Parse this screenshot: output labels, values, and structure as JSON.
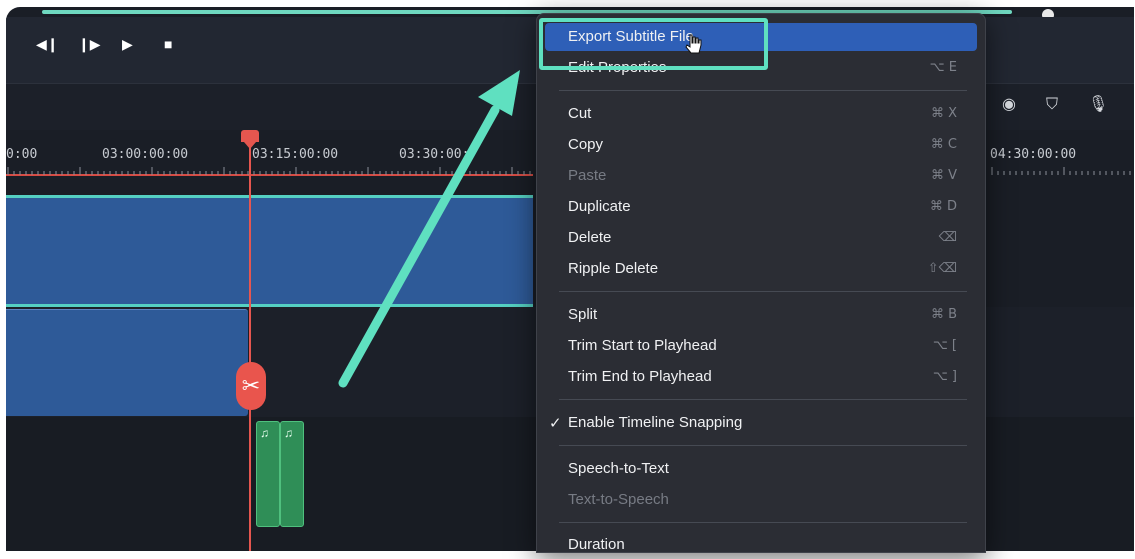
{
  "window": {
    "accent": "#5fe0c0",
    "playhead_color": "#e5564f"
  },
  "playback": {
    "buttons": [
      {
        "name": "prev-frame-icon",
        "glyph": "◀❙"
      },
      {
        "name": "next-frame-icon",
        "glyph": "❙▶"
      },
      {
        "name": "play-icon",
        "glyph": "▶"
      },
      {
        "name": "stop-icon",
        "glyph": "■"
      }
    ]
  },
  "toolbar": {
    "icons": [
      {
        "name": "render-preview-icon",
        "glyph": "◉"
      },
      {
        "name": "marker-icon",
        "glyph": "⛉"
      },
      {
        "name": "microphone-icon",
        "glyph": "🎙"
      }
    ]
  },
  "ruler": {
    "labels": [
      "0:00",
      "03:00:00:00",
      "03:15:00:00",
      "03:30:00:",
      "04:30:00:00"
    ]
  },
  "audio": {
    "glyph": "♫"
  },
  "scissor": {
    "glyph": "✂"
  },
  "menu": {
    "items": [
      {
        "label": "Export Subtitle File",
        "shortcut": "",
        "state": "highlight"
      },
      {
        "label": "Edit Properties",
        "shortcut": "⌥ E",
        "state": "normal"
      },
      {
        "label": "Cut",
        "shortcut": "⌘ X",
        "state": "normal"
      },
      {
        "label": "Copy",
        "shortcut": "⌘ C",
        "state": "normal"
      },
      {
        "label": "Paste",
        "shortcut": "⌘ V",
        "state": "disabled"
      },
      {
        "label": "Duplicate",
        "shortcut": "⌘ D",
        "state": "normal"
      },
      {
        "label": "Delete",
        "shortcut": "⌫",
        "state": "normal"
      },
      {
        "label": "Ripple Delete",
        "shortcut": "⇧⌫",
        "state": "normal"
      },
      {
        "label": "Split",
        "shortcut": "⌘ B",
        "state": "normal"
      },
      {
        "label": "Trim Start to Playhead",
        "shortcut": "⌥ [",
        "state": "normal"
      },
      {
        "label": "Trim End to Playhead",
        "shortcut": "⌥ ]",
        "state": "normal"
      },
      {
        "label": "Enable Timeline Snapping",
        "shortcut": "",
        "state": "checked",
        "check": "✓"
      },
      {
        "label": "Speech-to-Text",
        "shortcut": "",
        "state": "normal"
      },
      {
        "label": "Text-to-Speech",
        "shortcut": "",
        "state": "disabled"
      },
      {
        "label": "Duration",
        "shortcut": "",
        "state": "normal"
      }
    ]
  }
}
